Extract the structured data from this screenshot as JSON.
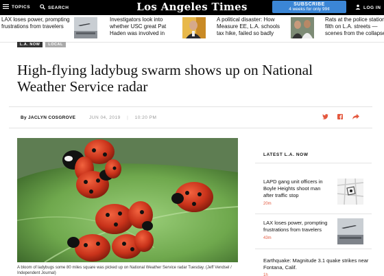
{
  "nav": {
    "topics_label": "TOPICS",
    "search_label": "SEARCH",
    "logo": "Los Angeles Times",
    "subscribe_label": "SUBSCRIBE",
    "subscribe_offer": "4 weeks for only 99¢",
    "login_label": "LOG IN"
  },
  "strip": {
    "stories": [
      {
        "text": "LAX loses power, prompting frustrations from travelers"
      },
      {
        "text": "Investigators look into whether USC great Pat Haden was involved in"
      },
      {
        "text": "A political disaster: How Measure EE, L.A. schools tax hike, failed so badly"
      },
      {
        "text": "Rats at the police station, filth on L.A. streets — scenes from the collapse"
      }
    ]
  },
  "tags": [
    "L.A. NOW",
    "LOCAL"
  ],
  "article": {
    "headline": "High-flying ladybug swarm shows up on National Weather Service radar",
    "byline": "By JACLYN COSGROVE",
    "date": "JUN 04, 2019",
    "time": "10:20 PM",
    "caption": "A bloom of ladybugs some 80 miles square was picked up on National Weather Service radar Tuesday. (Jeff Vendsel / Independent Journal)"
  },
  "sidebar": {
    "title": "LATEST L.A. NOW",
    "items": [
      {
        "text": "LAPD gang unit officers in Boyle Heights shoot man after traffic stop",
        "time": "20m"
      },
      {
        "text": "LAX loses power, prompting frustrations from travelers",
        "time": "43m"
      },
      {
        "text": "Earthquake: Magnitude 3.1 quake strikes near Fontana, Calif.",
        "time": "1h"
      }
    ]
  },
  "colors": {
    "accent": "#e4583e",
    "subscribe": "#3b86d6",
    "nav_bg": "#000000"
  }
}
